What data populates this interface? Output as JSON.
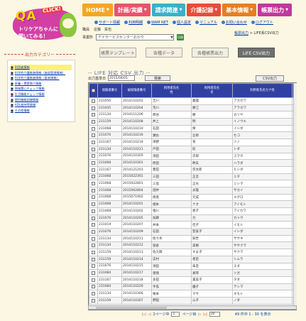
{
  "logo": {
    "qa": "QA",
    "click": "CLICK!",
    "line1": "トリケアちゃんに",
    "line2": "聞いてみる！"
  },
  "nav": [
    {
      "label": "HOME",
      "color": "#f5a623"
    },
    {
      "label": "計画/実績",
      "color": "#e8546a"
    },
    {
      "label": "請求関連",
      "color": "#3bb0c9"
    },
    {
      "label": "介護記録",
      "color": "#e74c3c"
    },
    {
      "label": "基本情報",
      "color": "#e67e22"
    },
    {
      "label": "帳票出力",
      "color": "#c0399a"
    }
  ],
  "toolbar": [
    "サポート情報",
    "利用明細",
    "WAM NET",
    "個人設定",
    "マニュアル",
    "お問い合わせ",
    "ログアウト"
  ],
  "user": {
    "label": "職員",
    "name": "近藤　栄也"
  },
  "office": {
    "label": "事業所",
    "value": "デイサービスセンターおかや",
    "button": "切替"
  },
  "breadcrumb": {
    "link": "帳票出力",
    "current": "LIFE系CSV出力"
  },
  "sidebar": {
    "title": "出力カテゴリー",
    "items": [
      "利用者情報",
      "科学的介護推進情報（施設管理情報）",
      "科学的介護推進情報（基本情報）",
      "栄養・摂食嚥下情報",
      "興味関心チェック情報",
      "生活機能チェック情報",
      "個別機能訓練情報",
      "ADL維持等情報",
      "その他情報"
    ]
  },
  "tabs": [
    "帳票テンプレート",
    "各種データ",
    "各種帳票出力",
    "LIFE CSV出力"
  ],
  "section_title": "LIFE 対応 CSV 出力",
  "filter": {
    "label": "出力基準日",
    "value": "2015/04/01",
    "search": "検索",
    "csv": "CSV出力"
  },
  "table": {
    "headers": [
      "",
      "保険者番号",
      "被保険者番号",
      "利用者氏名\n姓",
      "利用者氏名\n名",
      "利用者氏名カナ姓",
      "利"
    ],
    "rows": [
      [
        "231050",
        "2014110203",
        "吉川",
        "義雄",
        "アカガワ",
        "ヨ"
      ],
      [
        "231035",
        "2014110204",
        "荒川",
        "勝江",
        "アラカワ",
        "カ"
      ],
      [
        "231134",
        "2014111206",
        "荷谷",
        "勝",
        "カリヤ",
        "マ"
      ],
      [
        "231159",
        "2014110208",
        "井上",
        "明",
        "イノウエ",
        "ア"
      ],
      [
        "231068",
        "2014110210",
        "石田",
        "保",
        "イシダ",
        "タ"
      ],
      [
        "231076",
        "2014110216",
        "瀬古",
        "吾郎",
        "セコ",
        "ゴ"
      ],
      [
        "231167",
        "2014110219",
        "津野",
        "育",
        "ツノ",
        "タ"
      ],
      [
        "231134",
        "2014110221",
        "戸田",
        "稔",
        "トダ",
        "ミ"
      ],
      [
        "231076",
        "2014110305",
        "須田",
        "次郎",
        "スマタ",
        "ジ"
      ],
      [
        "231068",
        "2014110301",
        "原田",
        "幹夫",
        "ハラダ",
        "ミ"
      ],
      [
        "231167",
        "2014121201",
        "豊田",
        "宗太郎",
        "ヒシダ",
        "ヤ"
      ],
      [
        "231068",
        "2015022301",
        "三田",
        "正吾",
        "ミタ",
        "キ"
      ],
      [
        "231068",
        "2015022801",
        "三島",
        "正光",
        "ミシマ",
        "マ"
      ],
      [
        "231068",
        "2015062804",
        "酒井",
        "光雄",
        "サカイ",
        "ミ"
      ],
      [
        "231068",
        "2015071902",
        "目黒",
        "元成",
        "メグロ",
        "モ"
      ],
      [
        "231068",
        "2014110201",
        "相本",
        "ナオ",
        "アイモト",
        "ナ"
      ],
      [
        "231068",
        "2014110202",
        "相川",
        "恵子",
        "アイカワ",
        "ケ"
      ],
      [
        "231076",
        "2014110205",
        "加藤",
        "力",
        "カトウ",
        "チ"
      ],
      [
        "231019",
        "2014110207",
        "井本",
        "佳子",
        "イモト",
        "ヨ"
      ],
      [
        "231076",
        "2014110209",
        "石田",
        "登美子",
        "イシダ",
        "ト"
      ],
      [
        "231134",
        "2014110211",
        "佐々木",
        "知世",
        "ササキ",
        "ト"
      ],
      [
        "231134",
        "2014110212",
        "笹倉",
        "美樹",
        "ササクラ",
        "ミ"
      ],
      [
        "231159",
        "2014110213",
        "佐久間",
        "すま子",
        "サクマ",
        "ス"
      ],
      [
        "231159",
        "2014110214",
        "志村",
        "香苗",
        "シムラ",
        "カ"
      ],
      [
        "231076",
        "2014110215",
        "須田",
        "朱音",
        "スダ",
        "ア"
      ],
      [
        "231084",
        "2014110217",
        "曽我",
        "真琴",
        "ソガ",
        "マ"
      ],
      [
        "231167",
        "2014110218",
        "多田",
        "貴美子",
        "タダ",
        "キ"
      ],
      [
        "231084",
        "2014110220",
        "手島",
        "優子",
        "テシマ",
        "ユ"
      ],
      [
        "231134",
        "2014110306",
        "根本",
        "マサ",
        "ネモト",
        "マ"
      ],
      [
        "231159",
        "2014110307",
        "野田",
        "公子",
        "ノダ",
        "キ"
      ]
    ]
  },
  "pager": {
    "page_text": "2ページ中",
    "page_value": "1",
    "page_suffix": "ページ目",
    "per_page": "30",
    "count_text": "49 件中 1 - 30 を表示"
  }
}
